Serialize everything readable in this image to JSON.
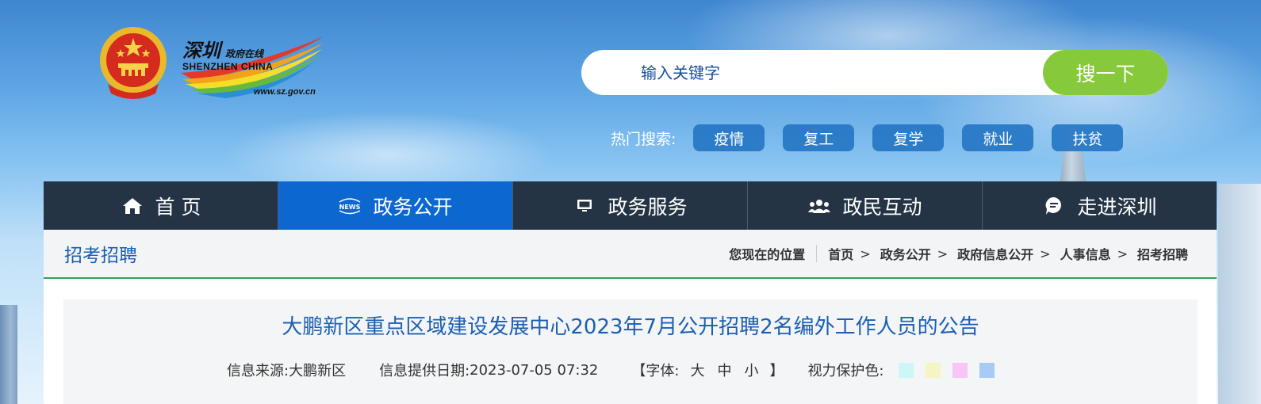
{
  "header": {
    "logo": {
      "cn_main": "深圳",
      "cn_small": "政府在线",
      "en": "SHENZHEN  CHINA",
      "url": "www.sz.gov.cn"
    }
  },
  "search": {
    "placeholder": "输入关键字",
    "button_label": "搜一下"
  },
  "hot_search": {
    "label": "热门搜索:",
    "tags": [
      "疫情",
      "复工",
      "复学",
      "就业",
      "扶贫"
    ]
  },
  "nav": {
    "items": [
      {
        "label": "首 页",
        "icon": "home-icon"
      },
      {
        "label": "政务公开",
        "icon": "news-icon"
      },
      {
        "label": "政务服务",
        "icon": "monitor-icon"
      },
      {
        "label": "政民互动",
        "icon": "people-icon"
      },
      {
        "label": "走进深圳",
        "icon": "chat-bubble-icon"
      }
    ],
    "active_index": 1
  },
  "section": {
    "title": "招考招聘"
  },
  "breadcrumb": {
    "lead": "您现在的位置",
    "items": [
      "首页",
      "政务公开",
      "政府信息公开",
      "人事信息",
      "招考招聘"
    ]
  },
  "article": {
    "title": "大鹏新区重点区域建设发展中心2023年7月公开招聘2名编外工作人员的公告",
    "source_label": "信息来源:",
    "source": "大鹏新区",
    "date_label": "信息提供日期:",
    "date": "2023-07-05 07:32",
    "font_label_open": "【字体:",
    "font_sizes": [
      "大",
      "中",
      "小"
    ],
    "font_label_close": "】",
    "eye_protect_label": "视力保护色:",
    "swatches": [
      "#cdf7f7",
      "#f4f5c3",
      "#f8c6f5",
      "#a7cbf5"
    ]
  },
  "colors": {
    "nav_bg": "#243444",
    "nav_active": "#0c67cf",
    "search_button": "#86c93a",
    "hot_tag": "#2576c4",
    "accent_text": "#1a5fb4",
    "divider_green": "#2ea55c"
  }
}
